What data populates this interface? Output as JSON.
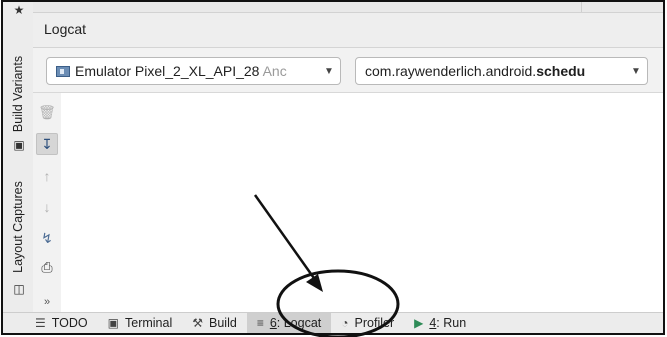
{
  "left_strip": {
    "build_variants": "Build Variants",
    "layout_captures": "Layout Captures"
  },
  "panel": {
    "title": "Logcat"
  },
  "device_select": {
    "value": "Emulator Pixel_2_XL_API_28",
    "suffix": "Anc"
  },
  "process_select": {
    "prefix": "com.raywenderlich.android.",
    "bold": "schedu"
  },
  "bottom_tabs": [
    {
      "icon": "list-icon",
      "label": "TODO"
    },
    {
      "icon": "terminal-icon",
      "label": "Terminal"
    },
    {
      "icon": "hammer-icon",
      "label": "Build"
    },
    {
      "icon": "logcat-icon",
      "mnemonic": "6",
      "rest": ": Logcat",
      "active": true
    },
    {
      "icon": "gauge-icon",
      "label": "Profiler"
    },
    {
      "icon": "run-icon",
      "mnemonic": "4",
      "rest": ": Run"
    }
  ],
  "colors": {
    "active_tab": "#cfcfcf",
    "annotation": "#111111"
  }
}
